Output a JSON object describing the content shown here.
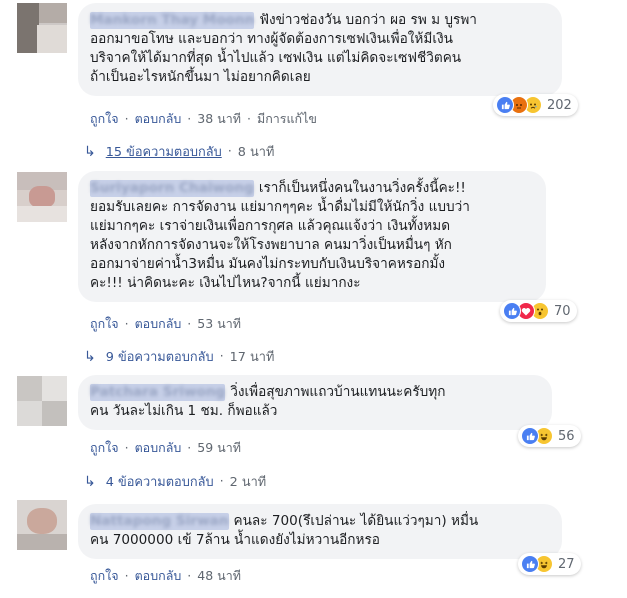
{
  "comments": [
    {
      "author": "Mankorn Thay Moonn",
      "lines": [
        "ฟังข่าวช่องวัน บอกว่า ผอ รพ ม บูรพา",
        "ออกมาขอโทษ และบอกว่า ทางผู้จัดต้องการเซฟเงินเพื่อให้มีเงิน",
        "บริจาคให้ได้มากที่สุด น้ำไปแล้ว เซฟเงิน แต่ไม่คิดจะเซฟชีวิตคน",
        "ถ้าเป็นอะไรหนักขึ้นมา ไม่อยากคิดเลย"
      ],
      "like_label": "ถูกใจ",
      "reply_label": "ตอบกลับ",
      "time": "38 นาที",
      "edited": "มีการแก้ไข",
      "reaction_count": "202",
      "reaction_icons": [
        "like-icon",
        "angry-icon",
        "sad-icon"
      ],
      "replies_label": "15 ข้อความตอบกลับ",
      "replies_time": "8 นาที"
    },
    {
      "author": "Suriyaporn Chaiwong",
      "lines": [
        "เราก็เป็นหนึ่งคนในงานวิ่งครั้งนี้คะ!!",
        "ยอมรับเลยคะ การจัดงาน แย่มากๆๆคะ น้ำดื่มไม่มีให้นักวิ่ง แบบว่า",
        "แย่มากๆคะ เราจ่ายเงินเพื่อการกุศล แล้วคุณแจ้งว่า เงินทั้งหมด",
        "หลังจากหักการจัดงานจะให้โรงพยาบาล คนมาวิ่งเป็นหมื่นๆ หัก",
        "ออกมาจ่ายค่าน้ำ3หมื่น มันคงไม่กระทบกับเงินบริจาคหรอกมั้ง",
        "คะ!!! น่าคิดนะคะ เงินไปไหน?จากนี้ แย่มากงะ"
      ],
      "like_label": "ถูกใจ",
      "reply_label": "ตอบกลับ",
      "time": "53 นาที",
      "reaction_count": "70",
      "reaction_icons": [
        "like-icon",
        "love-icon",
        "wow-icon"
      ],
      "replies_label": "9 ข้อความตอบกลับ",
      "replies_time": "17 นาที"
    },
    {
      "author": "Patchara Sriwong",
      "lines": [
        "วิ่งเพื่อสุขภาพแถวบ้านแทนนะครับทุก",
        "คน วันละไม่เกิน 1 ชม. ก็พอแล้ว"
      ],
      "like_label": "ถูกใจ",
      "reply_label": "ตอบกลับ",
      "time": "59 นาที",
      "reaction_count": "56",
      "reaction_icons": [
        "like-icon",
        "haha-icon"
      ],
      "replies_label": "4 ข้อความตอบกลับ",
      "replies_time": "2 นาที"
    },
    {
      "author": "Nattapong Sirwan",
      "lines": [
        "คนละ 700(รึเปล่านะ ได้ยินแว่วๆมา) หมื่น",
        "คน 7000000 เข้ 7ล้าน น้ำแดงยังไม่หวานอีกหรอ"
      ],
      "like_label": "ถูกใจ",
      "reply_label": "ตอบกลับ",
      "time": "48 นาที",
      "reaction_count": "27",
      "reaction_icons": [
        "like-icon",
        "haha-icon"
      ]
    }
  ],
  "colors": {
    "bubble": "#f2f3f5",
    "link": "#385898",
    "meta": "#606770",
    "like": "#4a7ff2",
    "love": "#f0284a",
    "haha": "#f7c531",
    "angry": "#e9710f"
  }
}
